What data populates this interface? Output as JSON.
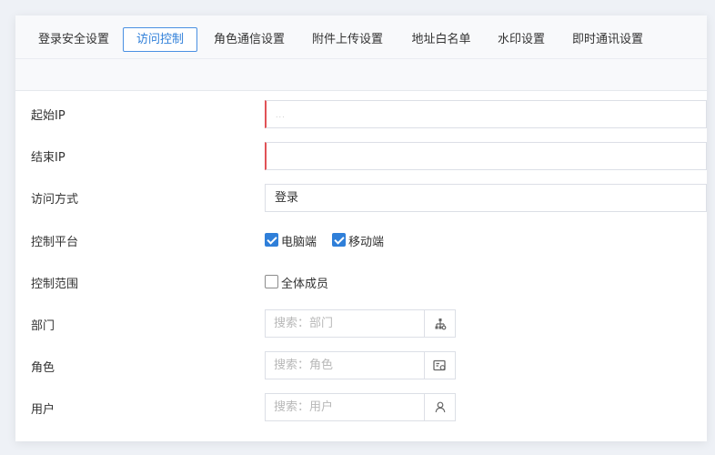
{
  "tabs": [
    {
      "label": "登录安全设置",
      "active": false
    },
    {
      "label": "访问控制",
      "active": true
    },
    {
      "label": "角色通信设置",
      "active": false
    },
    {
      "label": "附件上传设置",
      "active": false
    },
    {
      "label": "地址白名单",
      "active": false
    },
    {
      "label": "水印设置",
      "active": false
    },
    {
      "label": "即时通讯设置",
      "active": false
    }
  ],
  "form": {
    "start_ip": {
      "label": "起始IP",
      "value": "...",
      "required": true
    },
    "end_ip": {
      "label": "结束IP",
      "value": "",
      "required": true
    },
    "access_mode": {
      "label": "访问方式",
      "value": "登录"
    },
    "platform": {
      "label": "控制平台",
      "options": [
        {
          "label": "电脑端",
          "checked": true
        },
        {
          "label": "移动端",
          "checked": true
        }
      ]
    },
    "scope": {
      "label": "控制范围",
      "options": [
        {
          "label": "全体成员",
          "checked": false
        }
      ]
    },
    "department": {
      "label": "部门",
      "placeholder": "搜索：部门",
      "icon": "org-tree-icon"
    },
    "role": {
      "label": "角色",
      "placeholder": "搜索：角色",
      "icon": "role-card-icon"
    },
    "user": {
      "label": "用户",
      "placeholder": "搜索：用户",
      "icon": "user-icon"
    }
  },
  "colors": {
    "accent": "#2f7fd9",
    "required": "#e15256",
    "border": "#dcdfe6"
  }
}
